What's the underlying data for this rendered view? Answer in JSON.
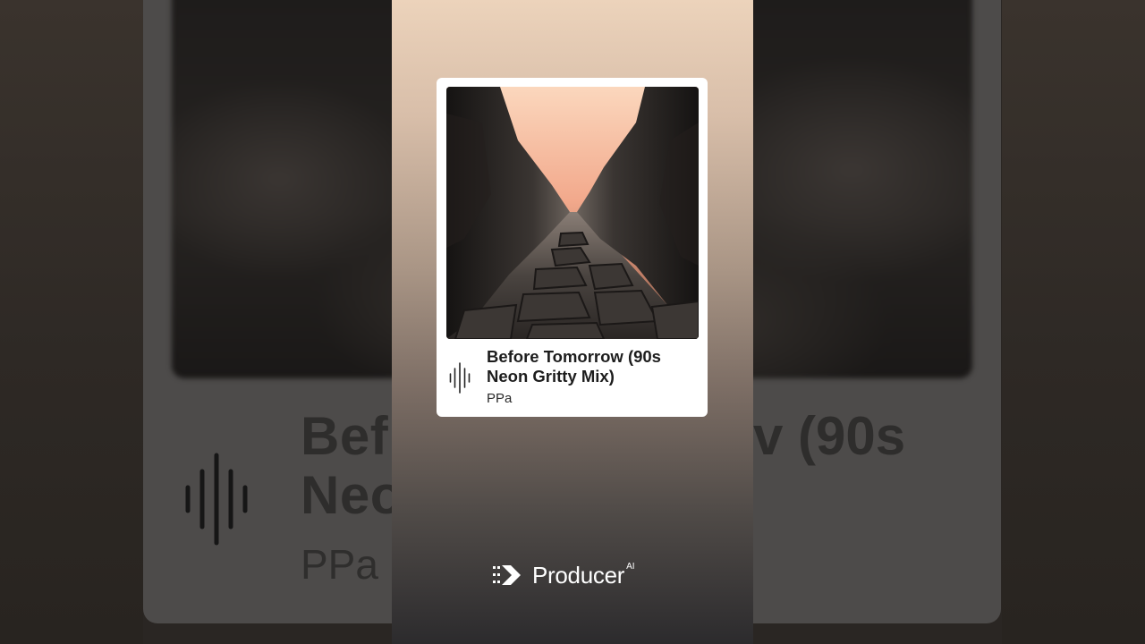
{
  "track": {
    "title": "Before Tomorrow (90s Neon Gritty Mix)",
    "artist": "PPa"
  },
  "background": {
    "title_left": "Bef",
    "title_right": "v (90s",
    "title_line2": "Neo",
    "artist": "PPa"
  },
  "brand": {
    "name": "Producer",
    "superscript": "AI"
  },
  "icons": {
    "waveform": "waveform-icon",
    "logo": "producer-logo-icon"
  },
  "colors": {
    "panel_top": "#ecd3bb",
    "panel_bottom": "#2c2b2d",
    "card": "#ffffff",
    "text_dark": "#1d1d1d"
  }
}
